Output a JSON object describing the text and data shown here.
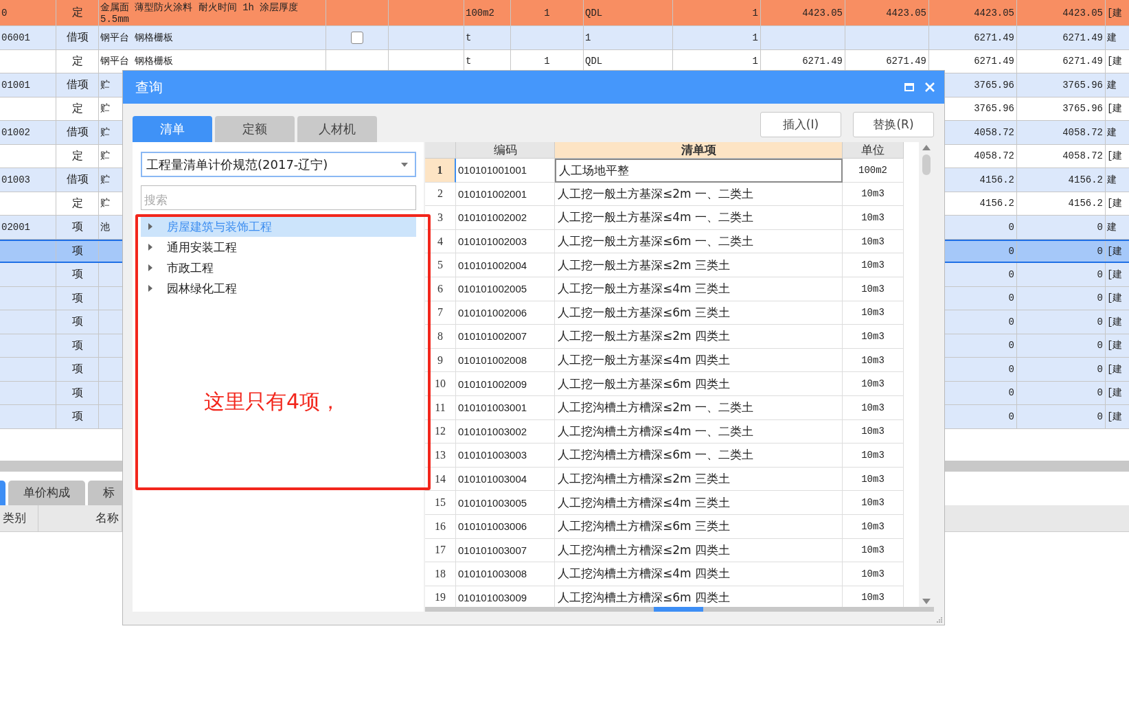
{
  "sheet": {
    "rows": [
      {
        "kind": "highlight",
        "selected": false,
        "column_1": "0",
        "column_2": "定",
        "column_3": "金属面 薄型防火涂料 耐火时间 1h 涂层厚度 5.5mm",
        "column_6": "100m2",
        "column_7": "1",
        "column_8": "QDL",
        "column_9": "1",
        "column_10": "4423.05",
        "column_11": "4423.05",
        "column_12": "4423.05",
        "column_13": "4423.05",
        "column_14": "[建"
      },
      {
        "kind": "bill",
        "selected": false,
        "column_1": "06001",
        "column_2": "借项",
        "column_3": "钢平台 钢格栅板",
        "checkbox": {
          "checked": false
        },
        "column_6": "t",
        "column_8": "1",
        "column_9": "1",
        "column_12": "6271.49",
        "column_13": "6271.49",
        "column_14": "建"
      },
      {
        "kind": "quota",
        "selected": false,
        "column_2": "定",
        "column_3": "钢平台 钢格栅板",
        "column_6": "t",
        "column_7": "1",
        "column_8": "QDL",
        "column_9": "1",
        "column_10": "6271.49",
        "column_11": "6271.49",
        "column_12": "6271.49",
        "column_13": "6271.49",
        "column_14": "[建"
      },
      {
        "kind": "bill",
        "selected": false,
        "column_1": "01001",
        "column_2": "借项",
        "column_3": "贮",
        "column_12": "3765.96",
        "column_13": "3765.96",
        "column_14": "建"
      },
      {
        "kind": "quota",
        "selected": false,
        "column_2": "定",
        "column_3": "贮",
        "column_12": "3765.96",
        "column_13": "3765.96",
        "column_14": "[建"
      },
      {
        "kind": "bill",
        "selected": false,
        "column_1": "01002",
        "column_2": "借项",
        "column_3": "贮",
        "column_12": "4058.72",
        "column_13": "4058.72",
        "column_14": "建"
      },
      {
        "kind": "quota",
        "selected": false,
        "column_2": "定",
        "column_3": "贮",
        "column_12": "4058.72",
        "column_13": "4058.72",
        "column_14": "[建"
      },
      {
        "kind": "bill",
        "selected": false,
        "column_1": "01003",
        "column_2": "借项",
        "column_3": "贮",
        "column_12": "4156.2",
        "column_13": "4156.2",
        "column_14": "建"
      },
      {
        "kind": "quota",
        "selected": false,
        "column_2": "定",
        "column_3": "贮",
        "column_12": "4156.2",
        "column_13": "4156.2",
        "column_14": "[建"
      },
      {
        "kind": "bill",
        "selected": false,
        "column_1": "02001",
        "column_2": "项",
        "column_3": "池",
        "column_12": "0",
        "column_13": "0",
        "column_14": "建"
      },
      {
        "kind": "bill",
        "selected": true,
        "column_2": "项",
        "column_12": "0",
        "column_13": "0",
        "column_14": "[建"
      },
      {
        "kind": "bill",
        "selected": false,
        "column_2": "项",
        "column_12": "0",
        "column_13": "0",
        "column_14": "[建"
      },
      {
        "kind": "bill",
        "selected": false,
        "column_2": "项",
        "column_12": "0",
        "column_13": "0",
        "column_14": "[建"
      },
      {
        "kind": "bill",
        "selected": false,
        "column_2": "项",
        "column_12": "0",
        "column_13": "0",
        "column_14": "[建"
      },
      {
        "kind": "bill",
        "selected": false,
        "column_2": "项",
        "column_12": "0",
        "column_13": "0",
        "column_14": "[建"
      },
      {
        "kind": "bill",
        "selected": false,
        "column_2": "项",
        "column_12": "0",
        "column_13": "0",
        "column_14": "[建"
      },
      {
        "kind": "bill",
        "selected": false,
        "column_2": "项",
        "column_12": "0",
        "column_13": "0",
        "column_14": "[建"
      },
      {
        "kind": "bill",
        "selected": false,
        "column_2": "项",
        "column_12": "0",
        "column_13": "0",
        "column_14": "[建"
      }
    ]
  },
  "bottom_panel": {
    "tabs": [
      {
        "selected": true
      },
      {
        "label": "单价构成",
        "selected": false
      },
      {
        "label": "标",
        "selected": false
      }
    ],
    "columns": [
      "类别",
      "名称"
    ]
  },
  "dialog": {
    "title": "查询",
    "tabs": [
      {
        "label": "清单",
        "selected": true
      },
      {
        "label": "定额",
        "selected": false
      },
      {
        "label": "人材机",
        "selected": false
      }
    ],
    "buttons": [
      "插入(I)",
      "替换(R)"
    ],
    "standard_select": {
      "value": "工程量清单计价规范(2017-辽宁)"
    },
    "search": {
      "placeholder": "搜索"
    },
    "tree": [
      {
        "label": "房屋建筑与装饰工程",
        "selected": true,
        "expanded": false
      },
      {
        "label": "通用安装工程",
        "selected": false,
        "expanded": false
      },
      {
        "label": "市政工程",
        "selected": false,
        "expanded": false
      },
      {
        "label": "园林绿化工程",
        "selected": false,
        "expanded": false
      }
    ],
    "table": {
      "columns": [
        {
          "label": "编码",
          "selected": false
        },
        {
          "label": "清单项",
          "selected": true
        },
        {
          "label": "单位",
          "selected": false
        }
      ],
      "rows": [
        {
          "index": "1",
          "code": "010101001001",
          "item": "人工场地平整",
          "unit": "100m2",
          "selected": true
        },
        {
          "index": "2",
          "code": "010101002001",
          "item": "人工挖一般土方基深≤2m 一、二类土",
          "unit": "10m3",
          "selected": false
        },
        {
          "index": "3",
          "code": "010101002002",
          "item": "人工挖一般土方基深≤4m 一、二类土",
          "unit": "10m3",
          "selected": false
        },
        {
          "index": "4",
          "code": "010101002003",
          "item": "人工挖一般土方基深≤6m 一、二类土",
          "unit": "10m3",
          "selected": false
        },
        {
          "index": "5",
          "code": "010101002004",
          "item": "人工挖一般土方基深≤2m 三类土",
          "unit": "10m3",
          "selected": false
        },
        {
          "index": "6",
          "code": "010101002005",
          "item": "人工挖一般土方基深≤4m 三类土",
          "unit": "10m3",
          "selected": false
        },
        {
          "index": "7",
          "code": "010101002006",
          "item": "人工挖一般土方基深≤6m 三类土",
          "unit": "10m3",
          "selected": false
        },
        {
          "index": "8",
          "code": "010101002007",
          "item": "人工挖一般土方基深≤2m 四类土",
          "unit": "10m3",
          "selected": false
        },
        {
          "index": "9",
          "code": "010101002008",
          "item": "人工挖一般土方基深≤4m 四类土",
          "unit": "10m3",
          "selected": false
        },
        {
          "index": "10",
          "code": "010101002009",
          "item": "人工挖一般土方基深≤6m 四类土",
          "unit": "10m3",
          "selected": false
        },
        {
          "index": "11",
          "code": "010101003001",
          "item": "人工挖沟槽土方槽深≤2m 一、二类土",
          "unit": "10m3",
          "selected": false
        },
        {
          "index": "12",
          "code": "010101003002",
          "item": "人工挖沟槽土方槽深≤4m 一、二类土",
          "unit": "10m3",
          "selected": false
        },
        {
          "index": "13",
          "code": "010101003003",
          "item": "人工挖沟槽土方槽深≤6m 一、二类土",
          "unit": "10m3",
          "selected": false
        },
        {
          "index": "14",
          "code": "010101003004",
          "item": "人工挖沟槽土方槽深≤2m 三类土",
          "unit": "10m3",
          "selected": false
        },
        {
          "index": "15",
          "code": "010101003005",
          "item": "人工挖沟槽土方槽深≤4m 三类土",
          "unit": "10m3",
          "selected": false
        },
        {
          "index": "16",
          "code": "010101003006",
          "item": "人工挖沟槽土方槽深≤6m 三类土",
          "unit": "10m3",
          "selected": false
        },
        {
          "index": "17",
          "code": "010101003007",
          "item": "人工挖沟槽土方槽深≤2m 四类土",
          "unit": "10m3",
          "selected": false
        },
        {
          "index": "18",
          "code": "010101003008",
          "item": "人工挖沟槽土方槽深≤4m 四类土",
          "unit": "10m3",
          "selected": false
        },
        {
          "index": "19",
          "code": "010101003009",
          "item": "人工挖沟槽土方槽深≤6m 四类土",
          "unit": "10m3",
          "selected": false
        }
      ]
    },
    "annotation": {
      "text": "这里只有4项，"
    }
  }
}
